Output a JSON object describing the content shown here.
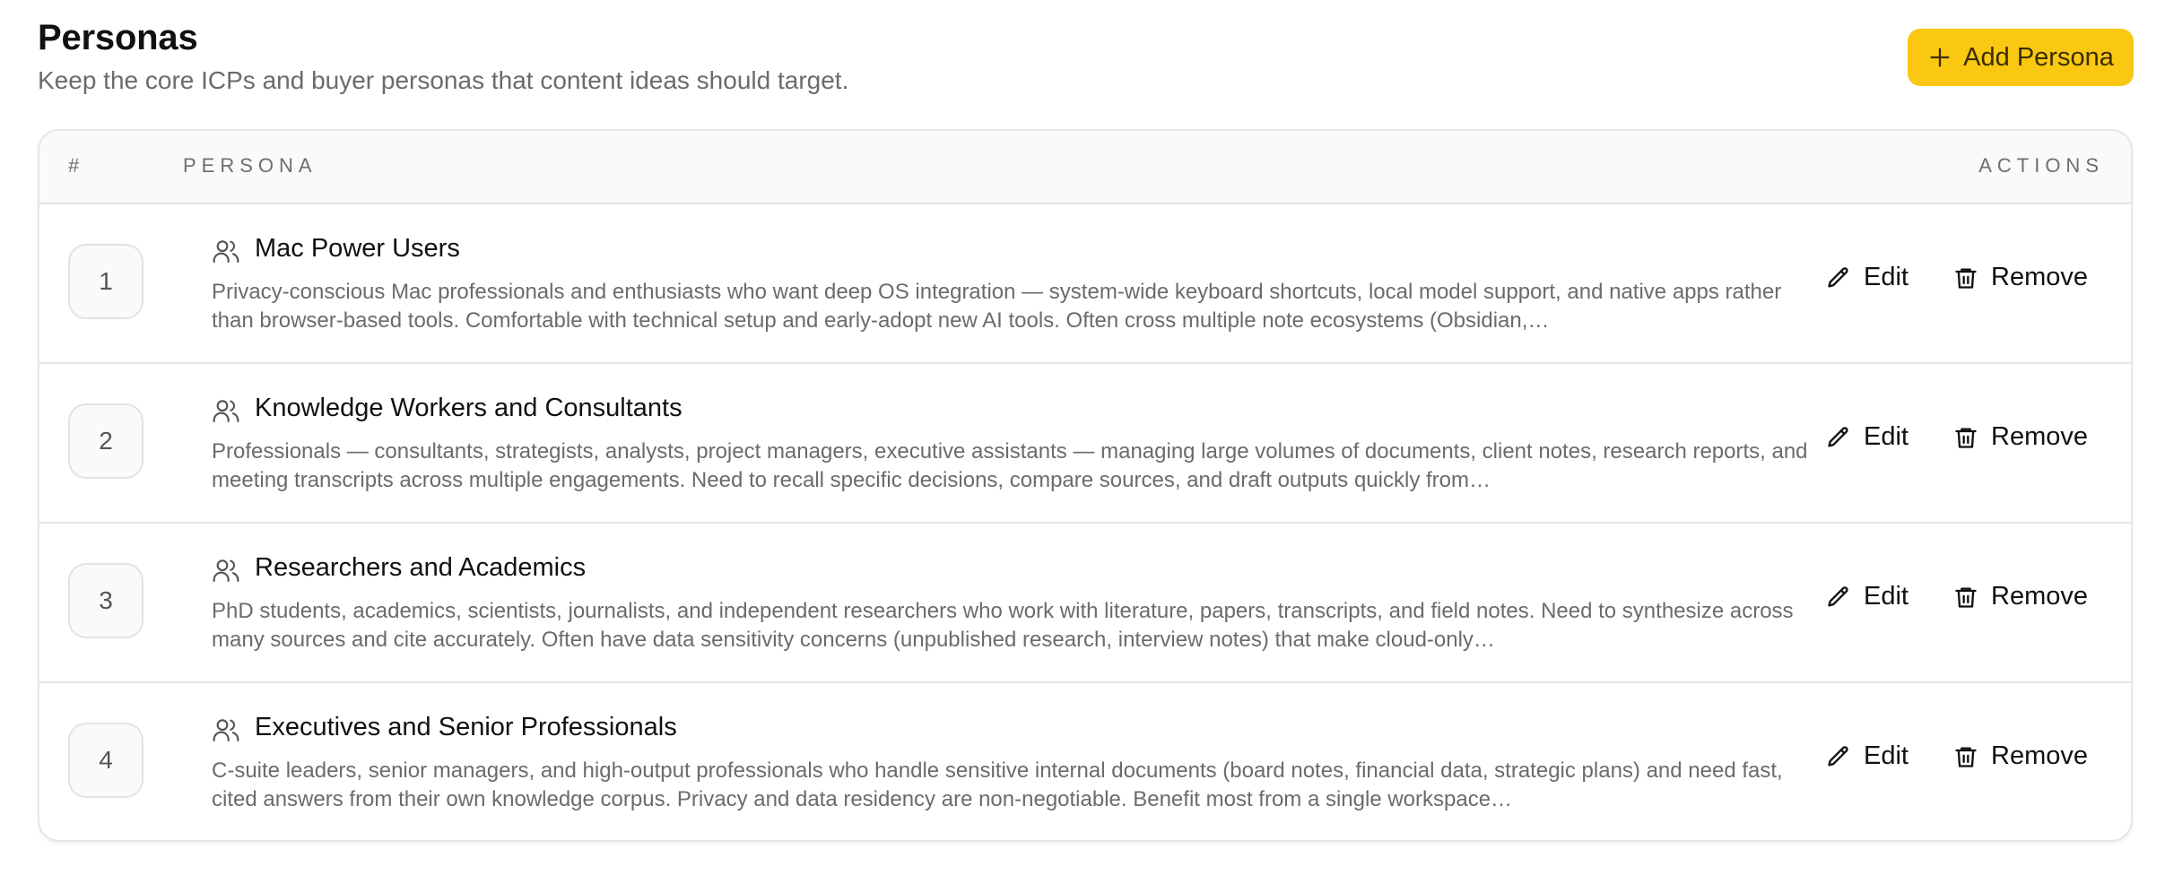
{
  "header": {
    "title": "Personas",
    "subtitle": "Keep the core ICPs and buyer personas that content ideas should target.",
    "add_button_label": "Add Persona"
  },
  "table": {
    "columns": {
      "number": "#",
      "persona": "PERSONA",
      "actions": "ACTIONS"
    },
    "rows": [
      {
        "number": "1",
        "name": "Mac Power Users",
        "description": "Privacy-conscious Mac professionals and enthusiasts who want deep OS integration — system-wide keyboard shortcuts, local model support, and native apps rather than browser-based tools. Comfortable with technical setup and early-adopt new AI tools. Often cross multiple note ecosystems (Obsidian,…",
        "edit_label": "Edit",
        "remove_label": "Remove"
      },
      {
        "number": "2",
        "name": "Knowledge Workers and Consultants",
        "description": "Professionals — consultants, strategists, analysts, project managers, executive assistants — managing large volumes of documents, client notes, research reports, and meeting transcripts across multiple engagements. Need to recall specific decisions, compare sources, and draft outputs quickly from…",
        "edit_label": "Edit",
        "remove_label": "Remove"
      },
      {
        "number": "3",
        "name": "Researchers and Academics",
        "description": "PhD students, academics, scientists, journalists, and independent researchers who work with literature, papers, transcripts, and field notes. Need to synthesize across many sources and cite accurately. Often have data sensitivity concerns (unpublished research, interview notes) that make cloud-only…",
        "edit_label": "Edit",
        "remove_label": "Remove"
      },
      {
        "number": "4",
        "name": "Executives and Senior Professionals",
        "description": "C-suite leaders, senior managers, and high-output professionals who handle sensitive internal documents (board notes, financial data, strategic plans) and need fast, cited answers from their own knowledge corpus. Privacy and data residency are non-negotiable. Benefit most from a single workspace…",
        "edit_label": "Edit",
        "remove_label": "Remove"
      }
    ]
  },
  "colors": {
    "accent": "#fac812",
    "text_primary": "#111111",
    "text_secondary": "#6b6b6b",
    "border": "#e6e6e6"
  },
  "icons": {
    "add": "plus-icon",
    "persona": "users-icon",
    "edit": "pencil-icon",
    "remove": "trash-icon"
  }
}
